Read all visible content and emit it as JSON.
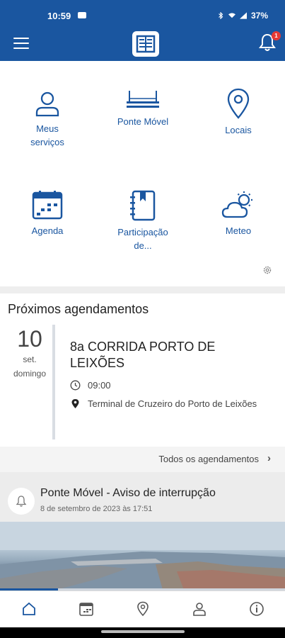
{
  "status_bar": {
    "time": "10:59",
    "battery": "37%"
  },
  "appbar": {
    "notification_count": "1"
  },
  "shortcuts": [
    {
      "label": "Meus serviços",
      "icon": "person-icon"
    },
    {
      "label": "Ponte Móvel",
      "icon": "bridge-icon"
    },
    {
      "label": "Locais",
      "icon": "location-pin-icon"
    },
    {
      "label": "Agenda",
      "icon": "calendar-icon"
    },
    {
      "label": "Participação de...",
      "icon": "notebook-icon"
    },
    {
      "label": "Meteo",
      "icon": "weather-cloud-sun-icon"
    }
  ],
  "upcoming": {
    "heading": "Próximos agendamentos",
    "day": "10",
    "month": "set.",
    "weekday": "domingo",
    "event_title": "8a CORRIDA PORTO DE LEIXÕES",
    "time": "09:00",
    "location": "Terminal de Cruzeiro do Porto de Leixões",
    "all_link": "Todos os agendamentos"
  },
  "notice": {
    "title": "Ponte Móvel - Aviso de interrupção",
    "date": "8 de setembro de 2023 às 17:51"
  },
  "colors": {
    "brand": "#1a56a0",
    "badge": "#e53935"
  },
  "bottom_nav": [
    "home-icon",
    "agenda-icon",
    "location-icon",
    "profile-icon",
    "info-icon"
  ]
}
